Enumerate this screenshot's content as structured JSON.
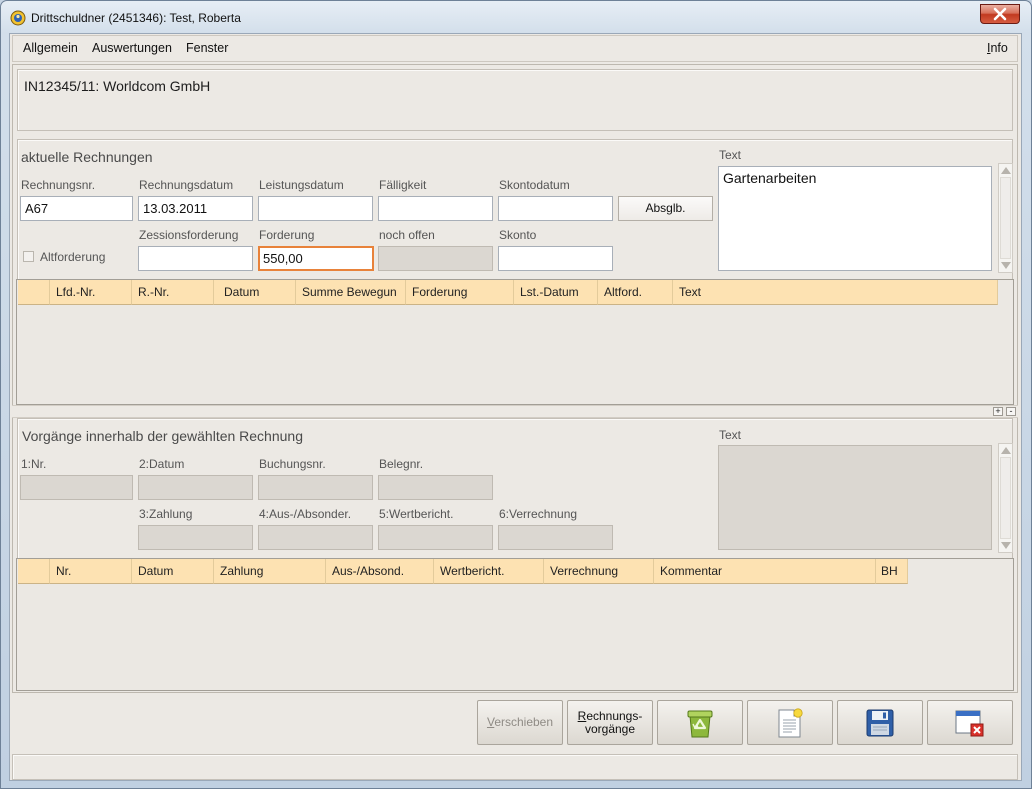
{
  "window": {
    "title": "Drittschuldner (2451346): Test, Roberta",
    "app_icon": "app-icon",
    "close_icon": "close-icon"
  },
  "menu": {
    "items": [
      "Allgemein",
      "Auswertungen",
      "Fenster"
    ],
    "info": "Info"
  },
  "header": {
    "case_title": "IN12345/11: Worldcom GmbH"
  },
  "invoices": {
    "title": "aktuelle Rechnungen",
    "rechnungsnr": {
      "label": "Rechnungsnr.",
      "value": "A67"
    },
    "rechnungsdatum": {
      "label": "Rechnungsdatum",
      "value": "13.03.2011"
    },
    "leistungsdatum": {
      "label": "Leistungsdatum",
      "value": ""
    },
    "faelligkeit": {
      "label": "Fälligkeit",
      "value": ""
    },
    "skontodatum": {
      "label": "Skontodatum",
      "value": ""
    },
    "absglb_button": "Absglb.",
    "altforderung": {
      "label": "Altforderung",
      "checked": false
    },
    "zessionsforderung": {
      "label": "Zessionsforderung",
      "value": ""
    },
    "forderung": {
      "label": "Forderung",
      "value": "550,00",
      "focused": true
    },
    "noch_offen": {
      "label": "noch offen",
      "value": "",
      "enabled": false
    },
    "skonto": {
      "label": "Skonto",
      "value": ""
    },
    "text": {
      "label": "Text",
      "value": "Gartenarbeiten"
    },
    "table": {
      "columns": [
        "Lfd.-Nr.",
        "R.-Nr.",
        "Datum",
        "Summe Bewegun",
        "Forderung",
        "Lst.-Datum",
        "Altford.",
        "Text"
      ],
      "rows": []
    }
  },
  "splitter": {
    "expand": "+",
    "collapse": "-"
  },
  "transactions": {
    "title": "Vorgänge innerhalb der gewählten Rechnung",
    "fields_enabled": false,
    "nr": {
      "label": "1:Nr.",
      "value": ""
    },
    "datum": {
      "label": "2:Datum",
      "value": ""
    },
    "buchungsnr": {
      "label": "Buchungsnr.",
      "value": ""
    },
    "belegnr": {
      "label": "Belegnr.",
      "value": ""
    },
    "zahlung": {
      "label": "3:Zahlung",
      "value": ""
    },
    "aus_absonder": {
      "label": "4:Aus-/Absonder.",
      "value": ""
    },
    "wertbericht": {
      "label": "5:Wertbericht.",
      "value": ""
    },
    "verrechnung": {
      "label": "6:Verrechnung",
      "value": ""
    },
    "text": {
      "label": "Text",
      "value": ""
    },
    "table": {
      "columns": [
        "Nr.",
        "Datum",
        "Zahlung",
        "Aus-/Absond.",
        "Wertbericht.",
        "Verrechnung",
        "Kommentar",
        "BH"
      ],
      "rows": []
    }
  },
  "actions": {
    "verschieben": {
      "label": "Verschieben",
      "enabled": false
    },
    "rechnungsvorgaenge": {
      "line1": "Rechnungs-",
      "line2": "vorgänge"
    },
    "icon_buttons": [
      {
        "icon": "recycle-bin-icon"
      },
      {
        "icon": "new-document-icon"
      },
      {
        "icon": "save-icon"
      },
      {
        "icon": "close-window-icon"
      }
    ]
  },
  "colors": {
    "window_bg": "#ece9e4",
    "table_header_bg": "#fde2b2",
    "focus_border": "#e8823a",
    "disabled_field_bg": "#dbd7d1"
  }
}
